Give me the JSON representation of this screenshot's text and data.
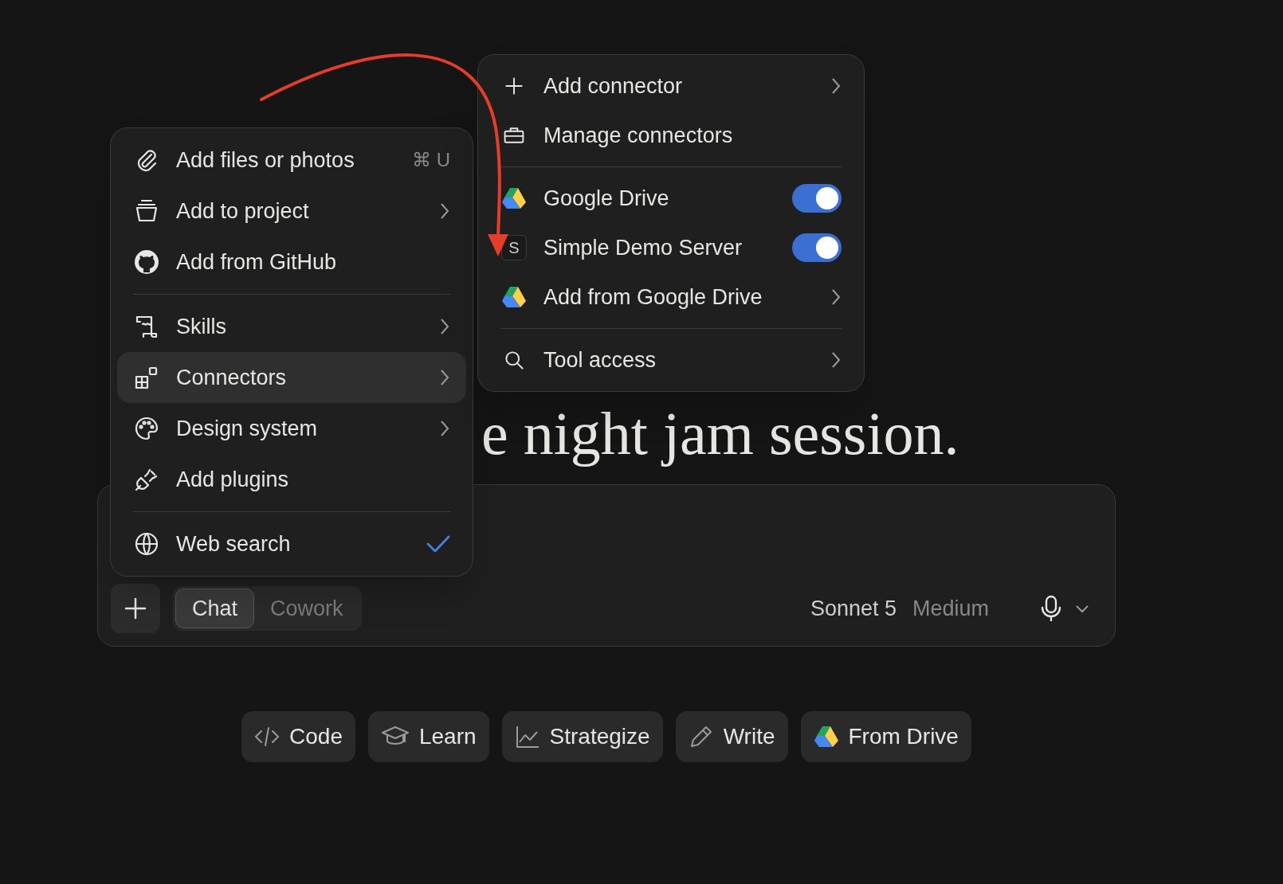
{
  "heading": {
    "text": "e night jam session."
  },
  "attach_menu": {
    "items": [
      {
        "kind": "item",
        "label": "Add files or photos",
        "shortcut": "⌘ U",
        "submenu": false,
        "selected": false,
        "checked": false
      },
      {
        "kind": "item",
        "label": "Add to project",
        "submenu": true,
        "selected": false,
        "checked": false
      },
      {
        "kind": "item",
        "label": "Add from GitHub",
        "submenu": false,
        "selected": false,
        "checked": false
      },
      {
        "kind": "divider"
      },
      {
        "kind": "item",
        "label": "Skills",
        "submenu": true,
        "selected": false,
        "checked": false
      },
      {
        "kind": "item",
        "label": "Connectors",
        "submenu": true,
        "selected": true,
        "checked": false
      },
      {
        "kind": "item",
        "label": "Design system",
        "submenu": true,
        "selected": false,
        "checked": false
      },
      {
        "kind": "item",
        "label": "Add plugins",
        "submenu": false,
        "selected": false,
        "checked": false
      },
      {
        "kind": "divider"
      },
      {
        "kind": "item",
        "label": "Web search",
        "submenu": false,
        "selected": false,
        "checked": true
      }
    ]
  },
  "connectors_menu": {
    "items": [
      {
        "kind": "action",
        "label": "Add connector",
        "submenu": true
      },
      {
        "kind": "action",
        "label": "Manage connectors",
        "submenu": false
      },
      {
        "kind": "divider"
      },
      {
        "kind": "toggle",
        "label": "Google Drive",
        "on": true
      },
      {
        "kind": "toggle",
        "label": "Simple Demo Server",
        "badge": "S",
        "on": true
      },
      {
        "kind": "action",
        "label": "Add from Google Drive",
        "submenu": true
      },
      {
        "kind": "divider"
      },
      {
        "kind": "action",
        "label": "Tool access",
        "submenu": true
      }
    ]
  },
  "composer": {
    "modes": [
      {
        "label": "Chat",
        "selected": true
      },
      {
        "label": "Cowork",
        "selected": false
      }
    ],
    "model": "Sonnet 5",
    "effort": "Medium"
  },
  "chips": [
    {
      "label": "Code"
    },
    {
      "label": "Learn"
    },
    {
      "label": "Strategize"
    },
    {
      "label": "Write"
    },
    {
      "label": "From Drive"
    }
  ]
}
